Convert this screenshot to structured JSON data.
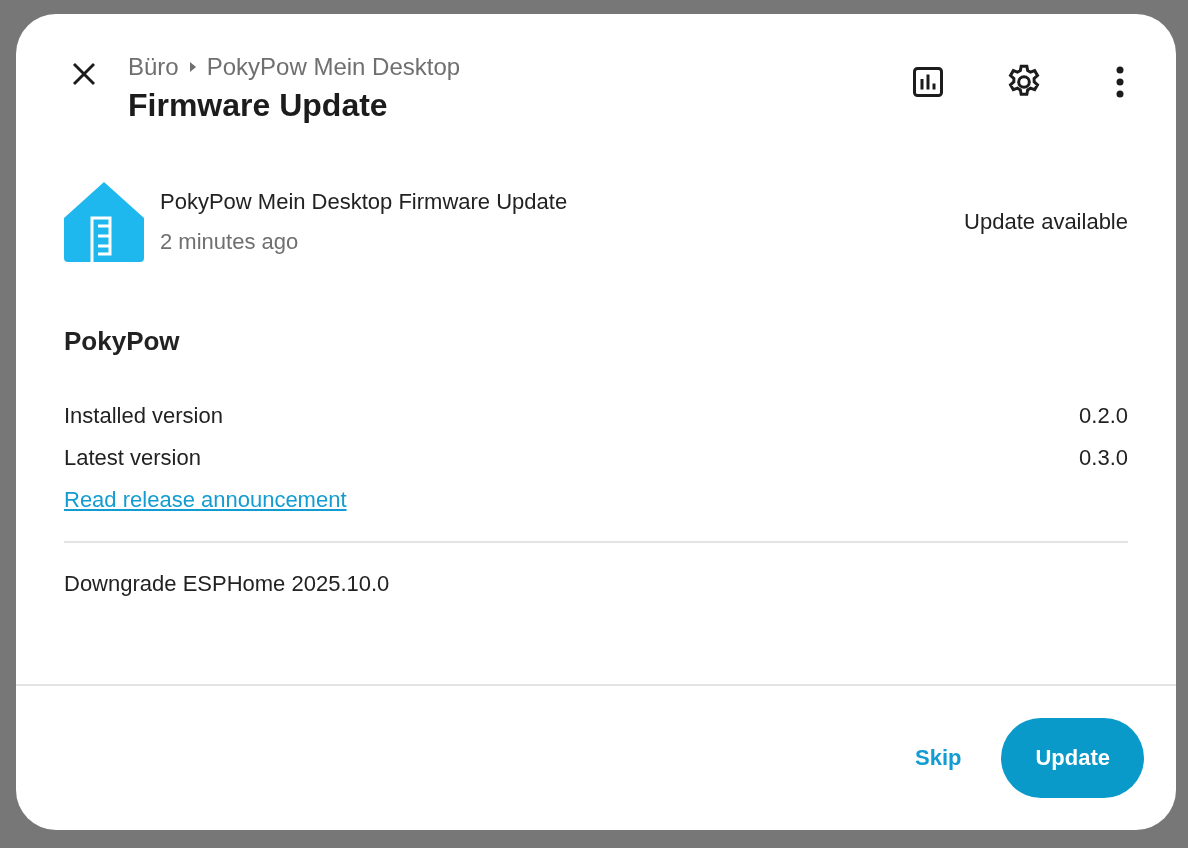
{
  "header": {
    "breadcrumb": [
      "Büro",
      "PokyPow Mein Desktop"
    ],
    "title": "Firmware Update"
  },
  "entity": {
    "name": "PokyPow Mein Desktop Firmware Update",
    "time": "2 minutes ago",
    "state": "Update available"
  },
  "details": {
    "heading": "PokyPow",
    "rows": [
      {
        "label": "Installed version",
        "value": "0.2.0"
      },
      {
        "label": "Latest version",
        "value": "0.3.0"
      }
    ],
    "link": "Read release announcement",
    "note": "Downgrade ESPHome 2025.10.0"
  },
  "buttons": [
    {
      "label": "Skip",
      "kind": "text"
    },
    {
      "label": "Update",
      "kind": "filled"
    }
  ]
}
